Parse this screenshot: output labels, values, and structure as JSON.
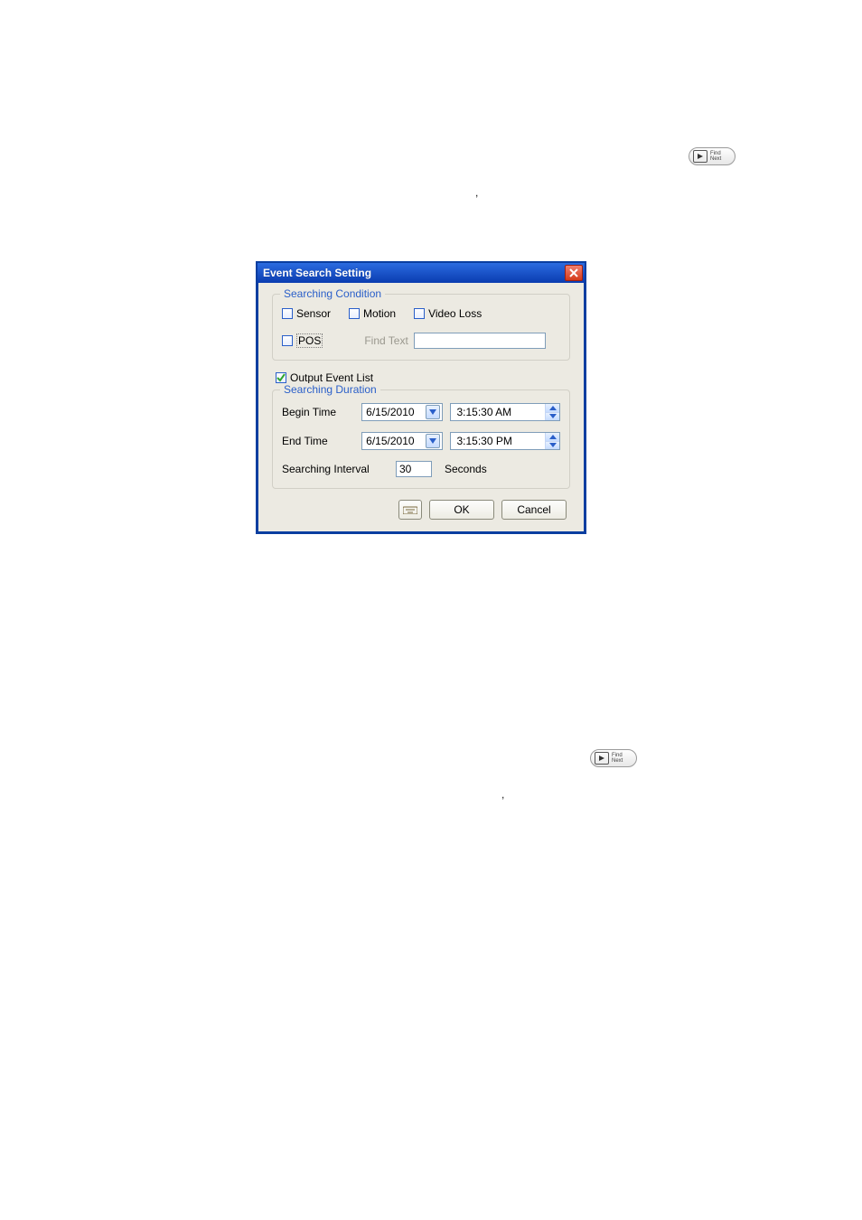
{
  "dialog": {
    "title": "Event Search Setting",
    "condition": {
      "legend": "Searching Condition",
      "sensor": {
        "label": "Sensor",
        "checked": false
      },
      "motion": {
        "label": "Motion",
        "checked": false
      },
      "video_loss": {
        "label": "Video Loss",
        "checked": false
      },
      "pos": {
        "label": "POS",
        "checked": false
      },
      "find_text_label": "Find Text",
      "find_text_value": ""
    },
    "output_event_list": {
      "label": "Output Event List",
      "checked": true
    },
    "duration": {
      "legend": "Searching Duration",
      "begin_label": "Begin Time",
      "begin_date": "6/15/2010",
      "begin_time": "3:15:30 AM",
      "end_label": "End Time",
      "end_date": "6/15/2010",
      "end_time": "3:15:30 PM",
      "interval_label": "Searching Interval",
      "interval_value": "30",
      "interval_unit": "Seconds"
    },
    "buttons": {
      "ok": "OK",
      "cancel": "Cancel"
    }
  },
  "findnext1": {
    "line1": "Find",
    "line2": "Next"
  },
  "findnext2": {
    "line1": "Find",
    "line2": "Next"
  },
  "punct": ","
}
